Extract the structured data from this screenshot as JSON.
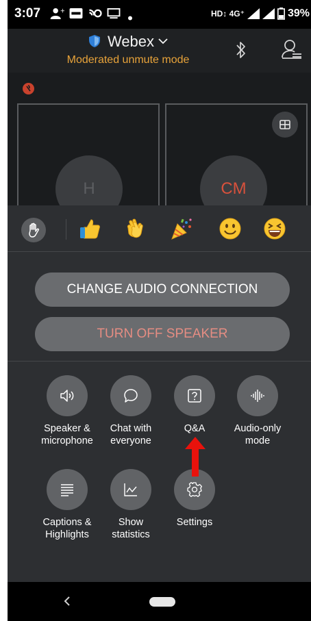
{
  "status_bar": {
    "time": "3:07",
    "network": "HD↕ 4G⁺",
    "battery": "39%"
  },
  "header": {
    "title": "Webex",
    "subtitle": "Moderated unmute mode"
  },
  "participants": [
    {
      "initials": "H"
    },
    {
      "initials": "CM"
    }
  ],
  "reactions": [
    "raise-hand",
    "thumbs-up",
    "clapping",
    "party",
    "smile",
    "laughing"
  ],
  "buttons": {
    "change_audio": "CHANGE AUDIO CONNECTION",
    "turn_off_speaker": "TURN OFF SPEAKER"
  },
  "menu": {
    "speaker": "Speaker & microphone",
    "chat": "Chat with everyone",
    "qa": "Q&A",
    "audio_only": "Audio-only mode",
    "captions": "Captions & Highlights",
    "stats": "Show statistics",
    "settings": "Settings"
  },
  "colors": {
    "accent": "#e8a33a",
    "danger_text": "#e58d83",
    "annotation_arrow": "#e8120c"
  }
}
